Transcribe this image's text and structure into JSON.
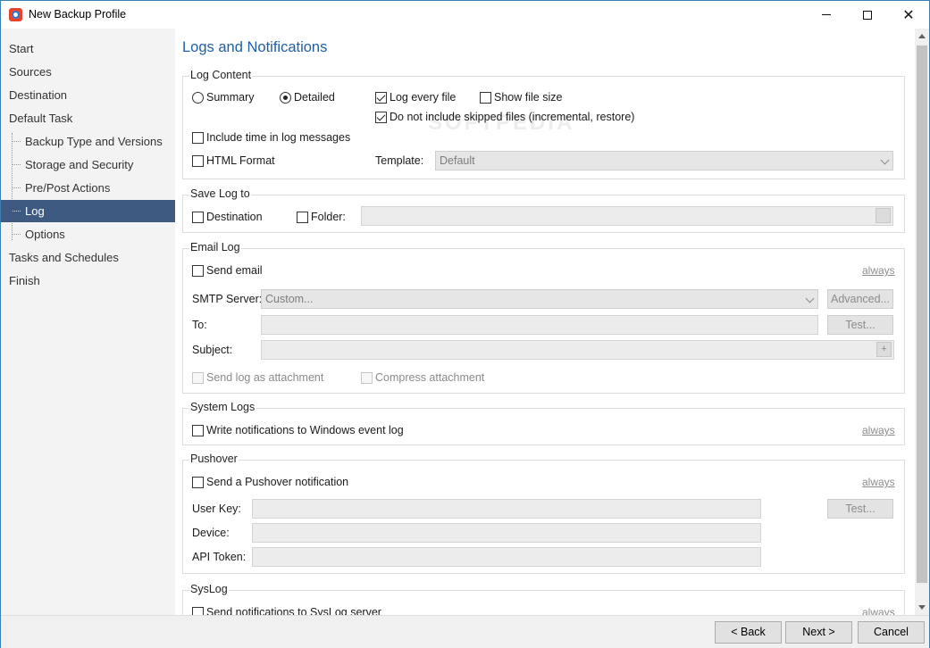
{
  "window": {
    "title": "New Backup Profile",
    "controls": {
      "minimize": "minimize-icon",
      "maximize": "maximize-icon",
      "close": "close-icon"
    }
  },
  "sidebar": {
    "items": [
      {
        "label": "Start",
        "level": 0,
        "active": false
      },
      {
        "label": "Sources",
        "level": 0,
        "active": false
      },
      {
        "label": "Destination",
        "level": 0,
        "active": false
      },
      {
        "label": "Default Task",
        "level": 0,
        "active": false
      },
      {
        "label": "Backup Type and Versions",
        "level": 1,
        "active": false
      },
      {
        "label": "Storage and Security",
        "level": 1,
        "active": false
      },
      {
        "label": "Pre/Post Actions",
        "level": 1,
        "active": false
      },
      {
        "label": "Log",
        "level": 1,
        "active": true
      },
      {
        "label": "Options",
        "level": 1,
        "active": false
      },
      {
        "label": "Tasks and Schedules",
        "level": 0,
        "active": false
      },
      {
        "label": "Finish",
        "level": 0,
        "active": false
      }
    ],
    "active_color": "#3f5a80"
  },
  "main": {
    "title": "Logs and Notifications",
    "title_color": "#1f5fa6",
    "log_content": {
      "group_title": "Log Content",
      "radio_summary": "Summary",
      "radio_detailed": "Detailed",
      "selected_radio": "Detailed",
      "log_every_file": "Log every file",
      "log_every_file_checked": true,
      "show_file_size": "Show file size",
      "show_file_size_checked": false,
      "no_skipped": "Do not include skipped files (incremental, restore)",
      "no_skipped_checked": true,
      "include_time": "Include time in log messages",
      "include_time_checked": false,
      "html_format": "HTML Format",
      "html_format_checked": false,
      "template_label": "Template:",
      "template_value": "Default"
    },
    "save_log": {
      "group_title": "Save Log to",
      "destination": "Destination",
      "folder": "Folder:",
      "folder_value": ""
    },
    "email_log": {
      "group_title": "Email Log",
      "send_email": "Send email",
      "always": "always",
      "smtp_label": "SMTP Server:",
      "smtp_value": "Custom...",
      "advanced_button": "Advanced...",
      "to_label": "To:",
      "to_value": "",
      "test_button": "Test...",
      "subject_label": "Subject:",
      "subject_value": "",
      "plus_button": "+",
      "send_attachment": "Send log as attachment",
      "compress_attachment": "Compress attachment"
    },
    "system_logs": {
      "group_title": "System Logs",
      "write_event_log": "Write notifications to Windows event log",
      "always": "always"
    },
    "pushover": {
      "group_title": "Pushover",
      "send_pushover": "Send a Pushover notification",
      "always": "always",
      "user_key_label": "User Key:",
      "device_label": "Device:",
      "api_token_label": "API Token:",
      "test_button": "Test..."
    },
    "syslog": {
      "group_title": "SysLog",
      "send_syslog": "Send notifications to SysLog server",
      "always": "always"
    }
  },
  "footer": {
    "back": "< Back",
    "next": "Next >",
    "cancel": "Cancel"
  },
  "watermark": "SOFTPEDIA"
}
